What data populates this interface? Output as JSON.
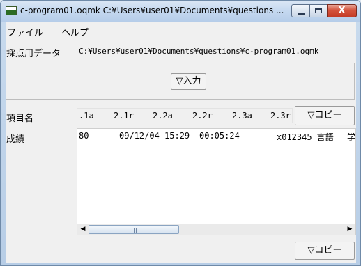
{
  "window": {
    "title": "c-program01.oqmk  C:¥Users¥user01¥Documents¥questions ...",
    "close_glyph": "X"
  },
  "menu": {
    "items": [
      "ファイル",
      "ヘルプ"
    ]
  },
  "scoring": {
    "label": "採点用データ",
    "path": "C:¥Users¥user01¥Documents¥questions¥c-program01.oqmk"
  },
  "input_button": {
    "label": "▽入力"
  },
  "items_row": {
    "label": "項目名",
    "headers": [
      ".1a",
      "2.1r",
      "2.2a",
      "2.2r",
      "2.3a",
      "2.3r"
    ],
    "copy_label": "▽コピー"
  },
  "grades_row": {
    "label": "成績",
    "values": [
      "80",
      "09/12/04 15:29",
      "00:05:24",
      "x012345 言語",
      "学"
    ]
  },
  "bottom_copy": {
    "label": "▽コピー"
  },
  "scrollbar": {
    "left_arrow": "◀",
    "right_arrow": "▶"
  }
}
